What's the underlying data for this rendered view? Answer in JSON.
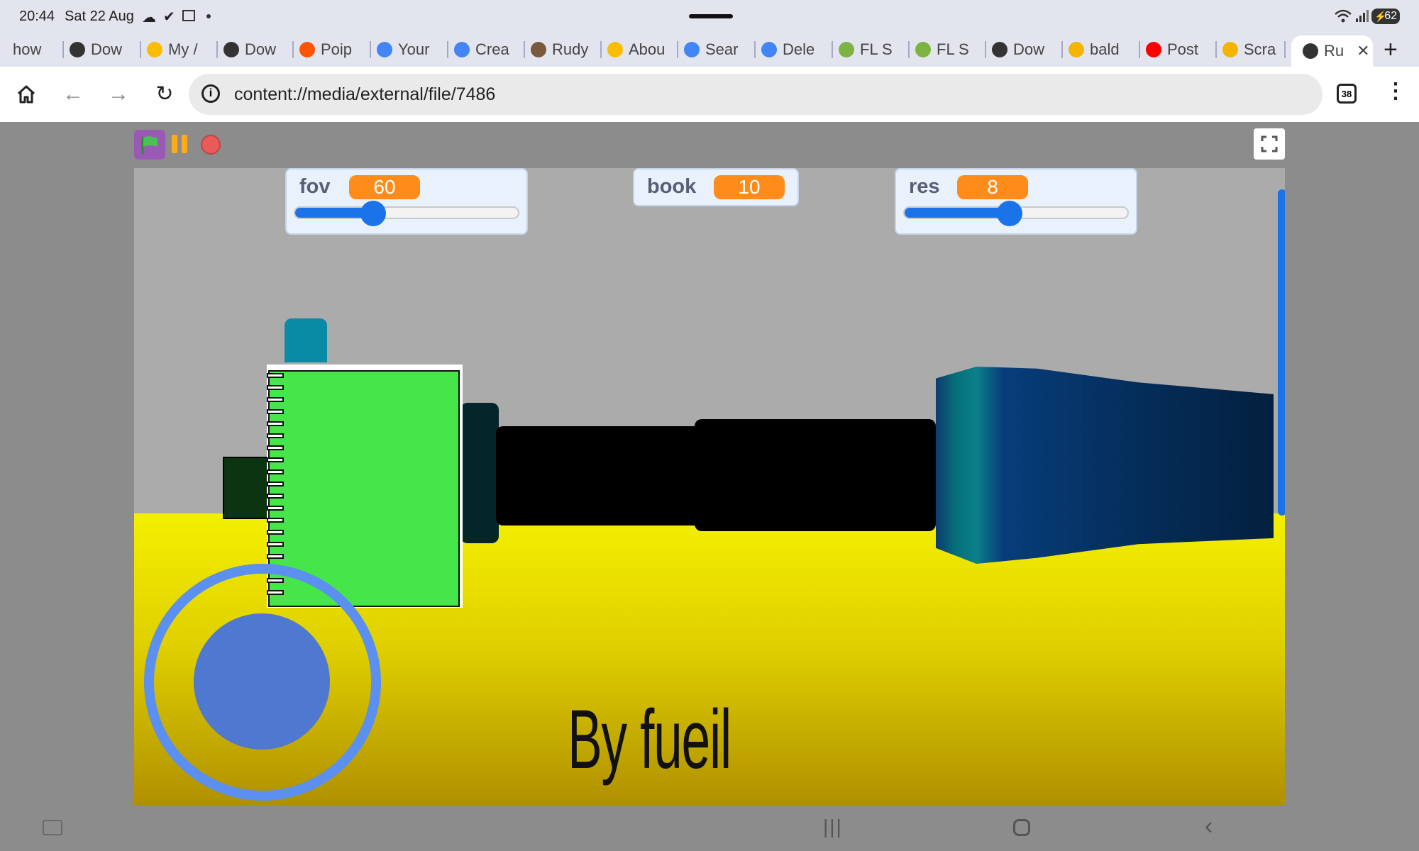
{
  "status_bar": {
    "time": "20:44",
    "date": "Sat 22 Aug",
    "battery": "62"
  },
  "tabs": [
    {
      "label": "how",
      "icon": "tab-partial-icon",
      "color": "#999999"
    },
    {
      "label": "Dow",
      "icon": "chrome-globe-icon",
      "color": "#333333"
    },
    {
      "label": "My /",
      "icon": "google-drive-icon",
      "color": "#fbbc04"
    },
    {
      "label": "Dow",
      "icon": "chrome-globe-icon",
      "color": "#333333"
    },
    {
      "label": "Poip",
      "icon": "soundcloud-icon",
      "color": "#ff5500"
    },
    {
      "label": "Your",
      "icon": "google-icon",
      "color": "#4285f4"
    },
    {
      "label": "Crea",
      "icon": "google-icon",
      "color": "#4285f4"
    },
    {
      "label": "Rudy",
      "icon": "game-character-icon",
      "color": "#7a5a3a"
    },
    {
      "label": "Abou",
      "icon": "google-drive-icon",
      "color": "#fbbc04"
    },
    {
      "label": "Sear",
      "icon": "google-icon",
      "color": "#4285f4"
    },
    {
      "label": "Dele",
      "icon": "google-icon",
      "color": "#4285f4"
    },
    {
      "label": "FL S",
      "icon": "android-icon",
      "color": "#7cb342"
    },
    {
      "label": "FL S",
      "icon": "android-icon",
      "color": "#7cb342"
    },
    {
      "label": "Dow",
      "icon": "chrome-globe-icon",
      "color": "#333333"
    },
    {
      "label": "bald",
      "icon": "baldi-coin-icon",
      "color": "#f4b400"
    },
    {
      "label": "Post",
      "icon": "youtube-icon",
      "color": "#ff0000"
    },
    {
      "label": "Scra",
      "icon": "baldi-coin-icon",
      "color": "#f4b400"
    },
    {
      "label": "Ru",
      "icon": "globe-icon",
      "color": "#333333",
      "active": true
    }
  ],
  "toolbar": {
    "url": "content://media/external/file/7486",
    "tab_count": "38"
  },
  "project": {
    "monitors": [
      {
        "name": "fov",
        "value": "60",
        "slider": true,
        "slider_fraction": 0.35
      },
      {
        "name": "book",
        "value": "10",
        "slider": false
      },
      {
        "name": "res",
        "value": "8",
        "slider": true,
        "slider_fraction": 0.47
      }
    ],
    "credit": "By fueil",
    "colors": {
      "ceiling": "#ababab",
      "floor": "#f4f000",
      "book": "#46e64a",
      "joystick": "#5b8ff0",
      "teal_wall": "#0a8ba5",
      "navy_wall": "#0c3b6e"
    }
  }
}
